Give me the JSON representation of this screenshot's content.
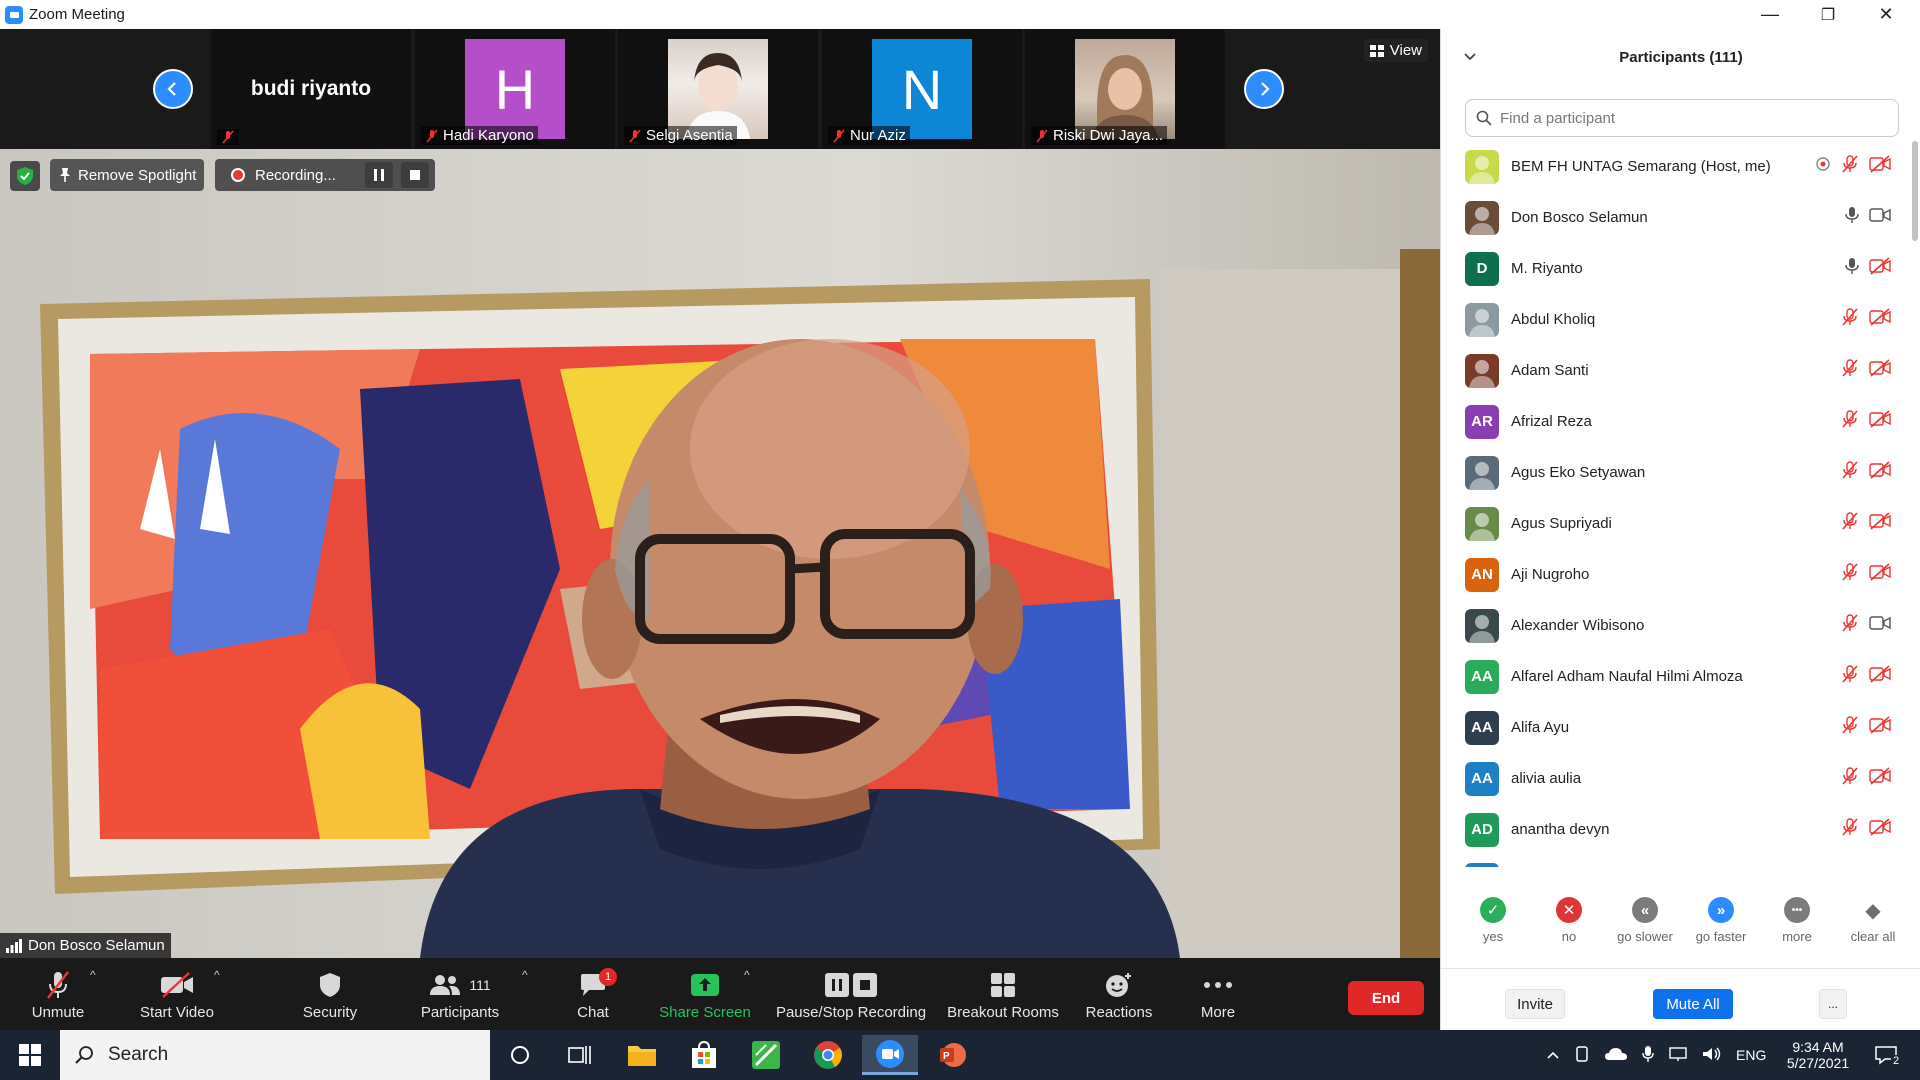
{
  "window": {
    "title": "Zoom Meeting",
    "controls": {
      "minimize": "—",
      "restore": "❐",
      "close": "✕"
    }
  },
  "strip": {
    "tiles": [
      {
        "name": "budi riyanto",
        "avatar": ""
      },
      {
        "name": "Hadi Karyono",
        "avatar": "H",
        "color": "#b44fc9"
      },
      {
        "name": "Selgi Asentia",
        "avatar": "photo"
      },
      {
        "name": "Nur Aziz",
        "avatar": "N",
        "color": "#0d86d6"
      },
      {
        "name": "Riski Dwi Jaya...",
        "avatar": "photo"
      }
    ],
    "view_label": "View"
  },
  "main": {
    "remove_spotlight": "Remove Spotlight",
    "recording": "Recording...",
    "speaker": "Don Bosco Selamun"
  },
  "toolbar": {
    "unmute": "Unmute",
    "start_video": "Start Video",
    "security": "Security",
    "participants": "Participants",
    "participants_count": "111",
    "chat": "Chat",
    "chat_badge": "1",
    "share_screen": "Share Screen",
    "pause_stop_recording": "Pause/Stop Recording",
    "breakout_rooms": "Breakout Rooms",
    "reactions": "Reactions",
    "more": "More",
    "end": "End"
  },
  "panel": {
    "title": "Participants (111)",
    "search_placeholder": "Find a participant",
    "participants": [
      {
        "name": "BEM FH UNTAG Semarang (Host, me)",
        "initials": "",
        "color": "#c8d94a",
        "mic": "muted",
        "video": "off",
        "recording": true
      },
      {
        "name": "Don Bosco Selamun",
        "initials": "",
        "color": "#6b4c3a",
        "mic": "on",
        "video": "on"
      },
      {
        "name": "M. Riyanto",
        "initials": "D",
        "color": "#0e6e4e",
        "mic": "on",
        "video": "off"
      },
      {
        "name": "Abdul Kholiq",
        "initials": "",
        "color": "#8a9aa0",
        "mic": "muted",
        "video": "off"
      },
      {
        "name": "Adam Santi",
        "initials": "",
        "color": "#7a3b2a",
        "mic": "muted",
        "video": "off"
      },
      {
        "name": "Afrizal Reza",
        "initials": "AR",
        "color": "#8a3fb0",
        "mic": "muted",
        "video": "off"
      },
      {
        "name": "Agus Eko Setyawan",
        "initials": "",
        "color": "#5a6a78",
        "mic": "muted",
        "video": "off"
      },
      {
        "name": "Agus Supriyadi",
        "initials": "",
        "color": "#6a8a4a",
        "mic": "muted",
        "video": "off"
      },
      {
        "name": "Aji Nugroho",
        "initials": "AN",
        "color": "#d9630e",
        "mic": "muted",
        "video": "off"
      },
      {
        "name": "Alexander Wibisono",
        "initials": "",
        "color": "#3a4a4a",
        "mic": "muted",
        "video": "on"
      },
      {
        "name": "Alfarel Adham Naufal Hilmi Almoza",
        "initials": "AA",
        "color": "#2aaa5a",
        "mic": "muted",
        "video": "off"
      },
      {
        "name": "Alifa Ayu",
        "initials": "AA",
        "color": "#2f3e4e",
        "mic": "muted",
        "video": "off"
      },
      {
        "name": "alivia aulia",
        "initials": "AA",
        "color": "#1d7fc4",
        "mic": "muted",
        "video": "off"
      },
      {
        "name": "anantha devyn",
        "initials": "AD",
        "color": "#1f9a57",
        "mic": "muted",
        "video": "off"
      }
    ],
    "reactions": [
      {
        "label": "yes",
        "color": "#2ab05a",
        "symbol": "✓"
      },
      {
        "label": "no",
        "color": "#e03535",
        "symbol": "✕"
      },
      {
        "label": "go slower",
        "color": "#7b7b7b",
        "symbol": "«"
      },
      {
        "label": "go faster",
        "color": "#2d8cff",
        "symbol": "»"
      },
      {
        "label": "more",
        "color": "#7b7b7b",
        "symbol": "•••"
      },
      {
        "label": "clear all",
        "color": "#6f6f6f",
        "symbol": "◆"
      }
    ],
    "invite": "Invite",
    "mute_all": "Mute All",
    "more": "..."
  },
  "taskbar": {
    "search_placeholder": "Search",
    "language": "ENG",
    "time": "9:34 AM",
    "date": "5/27/2021",
    "notifications": "2"
  }
}
